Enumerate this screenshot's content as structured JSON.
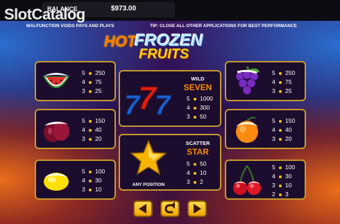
{
  "watermark": "SlotCatalog",
  "topbar": {
    "balance_label": "BALANCE",
    "balance_value": "$973.00"
  },
  "disclaimer": "MALFUNCTION VOIDS PAYS AND PLAYS",
  "tip": "TIP: CLOSE ALL OTHER APPLICATIONS FOR BEST PERFORMANCE",
  "logo": {
    "hot": "HOT",
    "frozen": "FROZEN",
    "fruits": "FRUITS"
  },
  "paytable": {
    "watermelon": [
      {
        "n": "5",
        "v": "250"
      },
      {
        "n": "4",
        "v": "75"
      },
      {
        "n": "3",
        "v": "25"
      }
    ],
    "grapes": [
      {
        "n": "5",
        "v": "250"
      },
      {
        "n": "4",
        "v": "75"
      },
      {
        "n": "3",
        "v": "25"
      }
    ],
    "plum": [
      {
        "n": "5",
        "v": "150"
      },
      {
        "n": "4",
        "v": "40"
      },
      {
        "n": "3",
        "v": "20"
      }
    ],
    "orange": [
      {
        "n": "5",
        "v": "150"
      },
      {
        "n": "4",
        "v": "40"
      },
      {
        "n": "3",
        "v": "20"
      }
    ],
    "lemon": [
      {
        "n": "5",
        "v": "100"
      },
      {
        "n": "4",
        "v": "30"
      },
      {
        "n": "3",
        "v": "10"
      }
    ],
    "cherries": [
      {
        "n": "5",
        "v": "100"
      },
      {
        "n": "4",
        "v": "30"
      },
      {
        "n": "3",
        "v": "10"
      },
      {
        "n": "2",
        "v": "3"
      }
    ],
    "wild": {
      "label1": "WILD",
      "label2": "SEVEN",
      "pays": [
        {
          "n": "5",
          "v": "1000"
        },
        {
          "n": "4",
          "v": "300"
        },
        {
          "n": "3",
          "v": "50"
        }
      ]
    },
    "scatter": {
      "label1": "SCATTER",
      "label2": "STAR",
      "note": "ANY POSITION",
      "pays": [
        {
          "n": "5",
          "v": "50"
        },
        {
          "n": "4",
          "v": "10"
        },
        {
          "n": "3",
          "v": "2"
        }
      ]
    }
  },
  "colors": {
    "panel_border": "#c99a2e",
    "accent_gold": "#ffc400",
    "title_orange": "#ff8a00"
  },
  "nav": {
    "prev_icon": "arrow-left-icon",
    "return_icon": "return-icon",
    "next_icon": "arrow-right-icon"
  }
}
